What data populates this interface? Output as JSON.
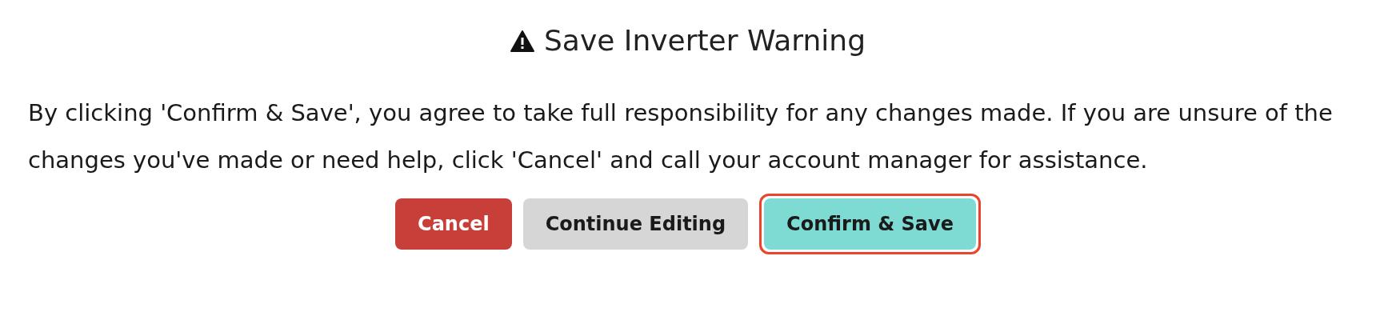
{
  "dialog": {
    "title": "Save Inverter Warning",
    "message": "By clicking 'Confirm & Save', you agree to take full responsibility for any changes made. If you are unsure of the changes you've made or need help, click 'Cancel' and call your account manager for assistance.",
    "buttons": [
      {
        "label": "Cancel",
        "kind": "danger",
        "focused": false
      },
      {
        "label": "Continue Editing",
        "kind": "neutral",
        "focused": false
      },
      {
        "label": "Confirm & Save",
        "kind": "primary",
        "focused": true
      }
    ]
  }
}
